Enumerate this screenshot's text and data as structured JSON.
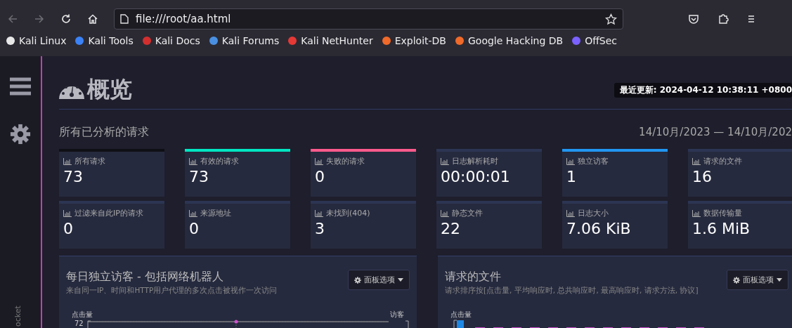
{
  "browser": {
    "url": "file:///root/aa.html",
    "back_disabled": true,
    "forward_disabled": true
  },
  "bookmarks": [
    {
      "label": "Kali Linux",
      "color": "#e8e8e8"
    },
    {
      "label": "Kali Tools",
      "color": "#3b82f6"
    },
    {
      "label": "Kali Docs",
      "color": "#d32f2f"
    },
    {
      "label": "Kali Forums",
      "color": "#4a90e2"
    },
    {
      "label": "Kali NetHunter",
      "color": "#e53935"
    },
    {
      "label": "Exploit-DB",
      "color": "#f06a2a"
    },
    {
      "label": "Google Hacking DB",
      "color": "#f06a2a"
    },
    {
      "label": "OffSec",
      "color": "#7b61ff"
    }
  ],
  "sidebar": {
    "vertical_label": "ocket"
  },
  "header": {
    "title": "概览",
    "last_update": "最近更新: 2024-04-12 10:38:11 +0800"
  },
  "section": {
    "title": "所有已分析的请求",
    "date_range": "14/10月/2023 — 14/10月/202"
  },
  "stats": [
    {
      "label": "所有请求",
      "value": "73",
      "color": "#0f1016"
    },
    {
      "label": "有效的请求",
      "value": "73",
      "color": "#00e6c3"
    },
    {
      "label": "失败的请求",
      "value": "0",
      "color": "#ff5a8c"
    },
    {
      "label": "日志解析耗时",
      "value": "00:00:01",
      "color": "#2c3553"
    },
    {
      "label": "独立访客",
      "value": "1",
      "color": "#2196f3"
    },
    {
      "label": "请求的文件",
      "value": "16",
      "color": "#2c3553"
    },
    {
      "label": "过滤来自此IP的请求",
      "value": "0",
      "color": "#2c3553"
    },
    {
      "label": "来源地址",
      "value": "0",
      "color": "#2c3553"
    },
    {
      "label": "未找到(404)",
      "value": "3",
      "color": "#2c3553"
    },
    {
      "label": "静态文件",
      "value": "22",
      "color": "#2c3553"
    },
    {
      "label": "日志大小",
      "value": "7.06 KiB",
      "color": "#2c3553"
    },
    {
      "label": "数据传输量",
      "value": "1.6 MiB",
      "color": "#2c3553"
    }
  ],
  "panels": [
    {
      "kind": "line",
      "title": "每日独立访客 - 包括网络机器人",
      "subtitle": "来自同一IP、时间和HTTP用户代理的多次点击被视作一次访问",
      "options": "面板选项",
      "y_label": "点击量",
      "y_label_right": "访客",
      "top_tick": "72"
    },
    {
      "kind": "bar",
      "title": "请求的文件",
      "subtitle": "请求排序按[点击量, 平均响应时, 总共响应时, 最高响应时, 请求方法, 协议]",
      "options": "面板选项",
      "y_label": "点击量"
    }
  ]
}
